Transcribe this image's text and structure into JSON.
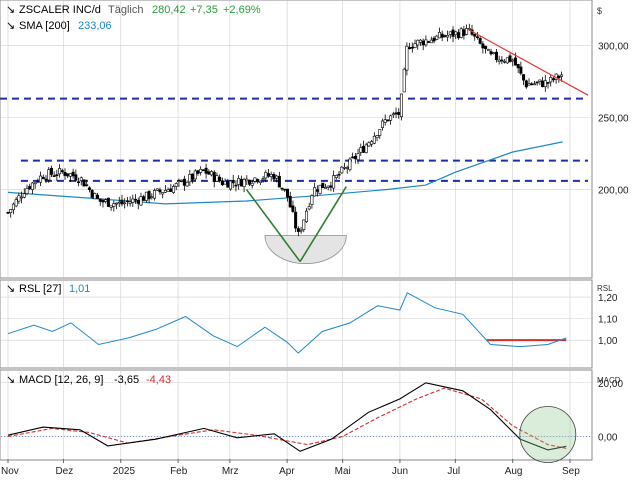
{
  "chart_data": [
    {
      "type": "candlestick",
      "panel": "price",
      "title": "ZSCALER INC/d",
      "period": "Täglich",
      "last": "280,42",
      "change": "+7,35",
      "change_pct": "+2,69%",
      "currency": "$",
      "indicator_label": "SMA [200]",
      "indicator_value": "233,06",
      "y_ticks": [
        200,
        250,
        300
      ],
      "y_tick_labels": [
        "200,00",
        "250,00",
        "300,00"
      ],
      "ylim": [
        140,
        330
      ],
      "x_months": [
        "Nov",
        "Dez",
        "2025",
        "Feb",
        "Mrz",
        "Apr",
        "Mai",
        "Jun",
        "Jul",
        "Aug",
        "Sep"
      ],
      "close_series": [
        {
          "date": "2024-11-01",
          "c": 184
        },
        {
          "date": "2024-11-10",
          "c": 200
        },
        {
          "date": "2024-11-20",
          "c": 210
        },
        {
          "date": "2024-12-01",
          "c": 212
        },
        {
          "date": "2024-12-10",
          "c": 208
        },
        {
          "date": "2024-12-20",
          "c": 192
        },
        {
          "date": "2025-01-01",
          "c": 190
        },
        {
          "date": "2025-01-15",
          "c": 195
        },
        {
          "date": "2025-02-01",
          "c": 203
        },
        {
          "date": "2025-02-15",
          "c": 213
        },
        {
          "date": "2025-02-25",
          "c": 205
        },
        {
          "date": "2025-03-05",
          "c": 205
        },
        {
          "date": "2025-03-15",
          "c": 208
        },
        {
          "date": "2025-03-25",
          "c": 210
        },
        {
          "date": "2025-04-01",
          "c": 196
        },
        {
          "date": "2025-04-07",
          "c": 168
        },
        {
          "date": "2025-04-15",
          "c": 200
        },
        {
          "date": "2025-04-25",
          "c": 205
        },
        {
          "date": "2025-05-05",
          "c": 218
        },
        {
          "date": "2025-05-15",
          "c": 233
        },
        {
          "date": "2025-05-25",
          "c": 249
        },
        {
          "date": "2025-06-01",
          "c": 253
        },
        {
          "date": "2025-06-05",
          "c": 300
        },
        {
          "date": "2025-06-20",
          "c": 305
        },
        {
          "date": "2025-07-01",
          "c": 308
        },
        {
          "date": "2025-07-08",
          "c": 310
        },
        {
          "date": "2025-07-20",
          "c": 292
        },
        {
          "date": "2025-08-01",
          "c": 290
        },
        {
          "date": "2025-08-08",
          "c": 273
        },
        {
          "date": "2025-08-20",
          "c": 274
        },
        {
          "date": "2025-08-28",
          "c": 280
        }
      ],
      "sma_series": [
        {
          "date": "2024-11-01",
          "v": 198
        },
        {
          "date": "2024-12-15",
          "v": 194
        },
        {
          "date": "2025-01-25",
          "v": 190
        },
        {
          "date": "2025-03-10",
          "v": 192
        },
        {
          "date": "2025-04-20",
          "v": 196
        },
        {
          "date": "2025-05-25",
          "v": 200
        },
        {
          "date": "2025-06-15",
          "v": 203
        },
        {
          "date": "2025-07-01",
          "v": 212
        },
        {
          "date": "2025-08-01",
          "v": 226
        },
        {
          "date": "2025-08-28",
          "v": 233
        }
      ],
      "horizontal_levels": [
        263,
        220,
        206
      ],
      "trendline": {
        "from": {
          "date": "2025-07-08",
          "v": 311
        },
        "to": {
          "date": "2025-09-01",
          "v": 264
        }
      },
      "annotations": [
        "v-shape bottom (Apr)",
        "rounded bottom shading"
      ]
    },
    {
      "type": "line",
      "panel": "rsl",
      "indicator_label": "RSL [27]",
      "indicator_value": "1,01",
      "y_ticks": [
        1.0,
        1.1,
        1.2
      ],
      "y_tick_labels": [
        "1,00",
        "1,10",
        "1,20"
      ],
      "ylim": [
        0.88,
        1.27
      ],
      "series": [
        {
          "date": "2024-11-01",
          "v": 1.03
        },
        {
          "date": "2024-11-15",
          "v": 1.07
        },
        {
          "date": "2024-11-25",
          "v": 1.04
        },
        {
          "date": "2024-12-05",
          "v": 1.08
        },
        {
          "date": "2024-12-20",
          "v": 0.98
        },
        {
          "date": "2025-01-05",
          "v": 1.01
        },
        {
          "date": "2025-01-20",
          "v": 1.05
        },
        {
          "date": "2025-02-05",
          "v": 1.11
        },
        {
          "date": "2025-02-20",
          "v": 1.02
        },
        {
          "date": "2025-03-05",
          "v": 0.97
        },
        {
          "date": "2025-03-20",
          "v": 1.06
        },
        {
          "date": "2025-04-01",
          "v": 0.99
        },
        {
          "date": "2025-04-07",
          "v": 0.94
        },
        {
          "date": "2025-04-20",
          "v": 1.04
        },
        {
          "date": "2025-05-05",
          "v": 1.08
        },
        {
          "date": "2025-05-20",
          "v": 1.16
        },
        {
          "date": "2025-06-01",
          "v": 1.14
        },
        {
          "date": "2025-06-05",
          "v": 1.22
        },
        {
          "date": "2025-06-20",
          "v": 1.15
        },
        {
          "date": "2025-07-05",
          "v": 1.12
        },
        {
          "date": "2025-07-20",
          "v": 0.98
        },
        {
          "date": "2025-08-05",
          "v": 0.97
        },
        {
          "date": "2025-08-20",
          "v": 0.98
        },
        {
          "date": "2025-08-30",
          "v": 1.01
        }
      ],
      "reference_segment": {
        "from_date": "2025-07-18",
        "to_date": "2025-08-30",
        "v": 1.0
      }
    },
    {
      "type": "line",
      "panel": "macd",
      "indicator_label": "MACD [12, 26, 9]",
      "macd_value": "-3,65",
      "signal_value": "-4,43",
      "y_ticks": [
        0,
        20
      ],
      "y_tick_labels": [
        "0,00",
        "20,00"
      ],
      "ylim": [
        -8,
        24
      ],
      "macd": [
        {
          "date": "2024-11-01",
          "v": 0.5
        },
        {
          "date": "2024-11-20",
          "v": 3.5
        },
        {
          "date": "2024-12-10",
          "v": 2.5
        },
        {
          "date": "2024-12-25",
          "v": -3.5
        },
        {
          "date": "2025-01-20",
          "v": -1
        },
        {
          "date": "2025-02-15",
          "v": 3
        },
        {
          "date": "2025-03-05",
          "v": -0.5
        },
        {
          "date": "2025-03-25",
          "v": 1
        },
        {
          "date": "2025-04-08",
          "v": -5.5
        },
        {
          "date": "2025-04-25",
          "v": -1
        },
        {
          "date": "2025-05-15",
          "v": 9
        },
        {
          "date": "2025-06-01",
          "v": 14
        },
        {
          "date": "2025-06-15",
          "v": 20
        },
        {
          "date": "2025-07-05",
          "v": 17
        },
        {
          "date": "2025-07-20",
          "v": 10
        },
        {
          "date": "2025-08-05",
          "v": -1
        },
        {
          "date": "2025-08-20",
          "v": -5
        },
        {
          "date": "2025-08-30",
          "v": -3.65
        }
      ],
      "signal": [
        {
          "date": "2024-11-01",
          "v": 0
        },
        {
          "date": "2024-11-25",
          "v": 3
        },
        {
          "date": "2024-12-15",
          "v": 1.5
        },
        {
          "date": "2025-01-05",
          "v": -2.5
        },
        {
          "date": "2025-02-01",
          "v": 0.5
        },
        {
          "date": "2025-02-20",
          "v": 2.5
        },
        {
          "date": "2025-03-15",
          "v": 0.5
        },
        {
          "date": "2025-04-12",
          "v": -3
        },
        {
          "date": "2025-05-01",
          "v": 0
        },
        {
          "date": "2025-05-20",
          "v": 7
        },
        {
          "date": "2025-06-10",
          "v": 14
        },
        {
          "date": "2025-06-25",
          "v": 18
        },
        {
          "date": "2025-07-15",
          "v": 14
        },
        {
          "date": "2025-08-01",
          "v": 4
        },
        {
          "date": "2025-08-20",
          "v": -3
        },
        {
          "date": "2025-08-30",
          "v": -4.43
        }
      ],
      "highlight": "circle around Aug cross"
    }
  ],
  "colors": {
    "up_candle": "#ffffff",
    "down_candle": "#000000",
    "sma": "#1e88c8",
    "rsl": "#1e88c8",
    "macd": "#000000",
    "signal": "#d32f2f",
    "level_lines": "#1a2fa8",
    "trendline": "#e53935",
    "v_bottom": "#2e7d32",
    "value_pos": "#2e9c3c",
    "value_neg": "#d32f2f",
    "grid": "#cfcfcf"
  }
}
